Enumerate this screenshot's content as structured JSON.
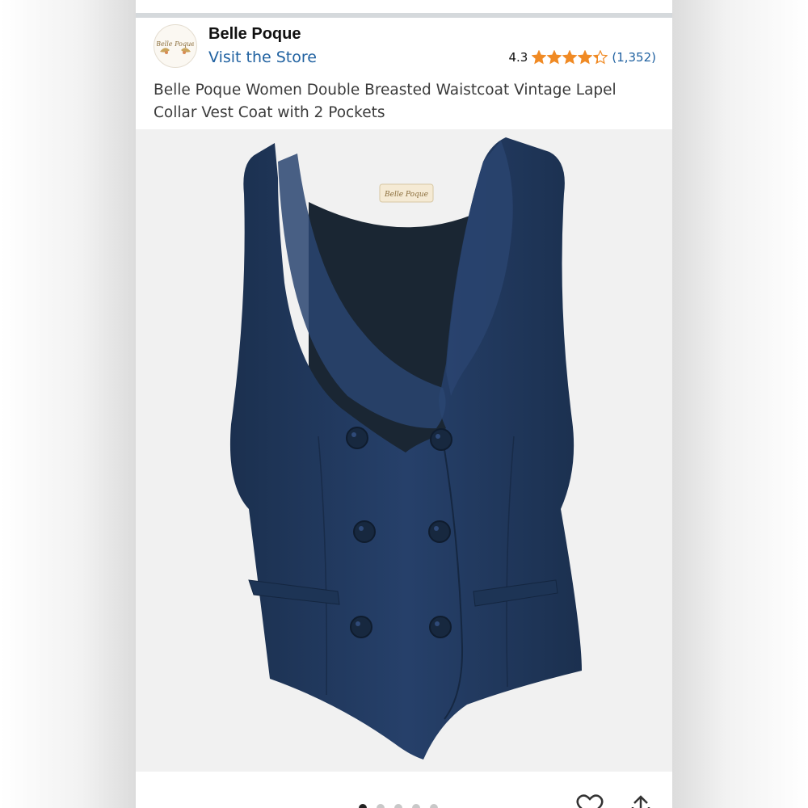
{
  "brand": {
    "name": "Belle Poque",
    "logo_text": "Belle Poque",
    "store_link": "Visit the Store"
  },
  "rating": {
    "value": "4.3",
    "stars": 4.3,
    "reviews": "(1,352)"
  },
  "product": {
    "title": "Belle Poque Women Double Breasted Waistcoat Vintage Lapel Collar Vest Coat with 2 Pockets",
    "image_label": "Belle Poque",
    "vest_color": "#223a5e"
  },
  "carousel": {
    "count": 5,
    "active_index": 0
  },
  "colors": {
    "link": "#2162a1",
    "star": "#f08a24",
    "top_bar": "#d5d9dc"
  },
  "icons": [
    "star-icon",
    "heart-icon",
    "share-icon"
  ]
}
